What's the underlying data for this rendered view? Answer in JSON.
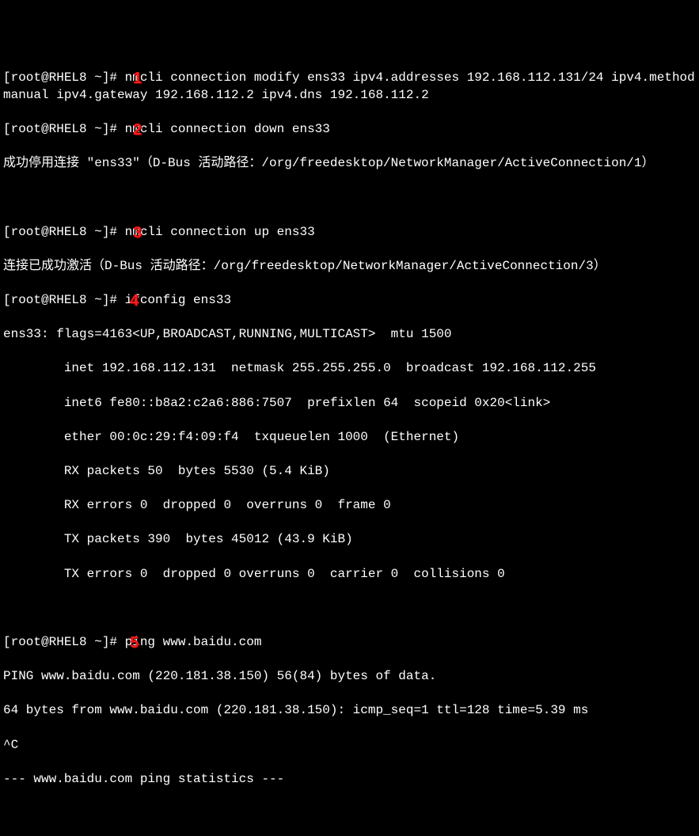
{
  "annotations": {
    "a1": "1",
    "a2": "2",
    "a3": "3",
    "a4": "4",
    "a5": "5"
  },
  "prompts": {
    "p": "[root@RHEL8 ~]# "
  },
  "commands": {
    "cmd1": "nmcli connection modify ens33 ipv4.addresses 192.168.112.131/24 ipv4.method manual ipv4.gateway 192.168.112.2 ipv4.dns 192.168.112.2",
    "cmd2": "nmcli connection down ens33",
    "cmd3": "nmcli connection up ens33",
    "cmd4": "ifconfig ens33",
    "cmd5": "ping www.baidu.com"
  },
  "outputs": {
    "down": "成功停用连接 \"ens33\"（D-Bus 活动路径：/org/freedesktop/NetworkManager/ActiveConnection/1）",
    "up": "连接已成功激活（D-Bus 活动路径：/org/freedesktop/NetworkManager/ActiveConnection/3）",
    "ifconfig_l1": "ens33: flags=4163<UP,BROADCAST,RUNNING,MULTICAST>  mtu 1500",
    "ifconfig_l2": "        inet 192.168.112.131  netmask 255.255.255.0  broadcast 192.168.112.255",
    "ifconfig_l3": "        inet6 fe80::b8a2:c2a6:886:7507  prefixlen 64  scopeid 0x20<link>",
    "ifconfig_l4": "        ether 00:0c:29:f4:09:f4  txqueuelen 1000  (Ethernet)",
    "ifconfig_l5": "        RX packets 50  bytes 5530 (5.4 KiB)",
    "ifconfig_l6": "        RX errors 0  dropped 0  overruns 0  frame 0",
    "ifconfig_l7": "        TX packets 390  bytes 45012 (43.9 KiB)",
    "ifconfig_l8": "        TX errors 0  dropped 0 overruns 0  carrier 0  collisions 0",
    "ping_l1": "PING www.baidu.com (220.181.38.150) 56(84) bytes of data.",
    "ping_l2": "64 bytes from www.baidu.com (220.181.38.150): icmp_seq=1 ttl=128 time=5.39 ms",
    "ping_ctrl": "^C",
    "ping_stats": "--- www.baidu.com ping statistics ---"
  }
}
